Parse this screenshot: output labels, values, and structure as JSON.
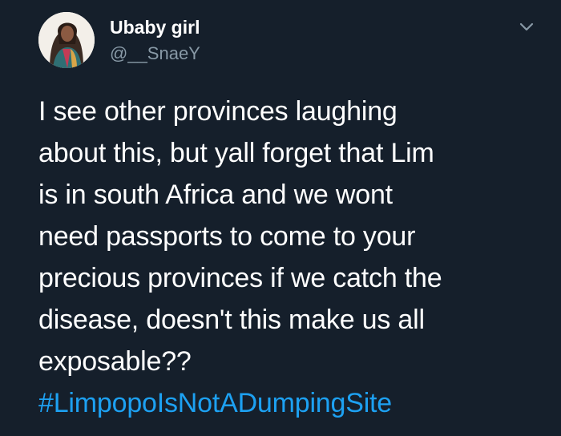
{
  "author": {
    "display_name": "Ubaby girl",
    "handle": "@__SnaeY"
  },
  "menu": {
    "caret_icon": "chevron-down-icon"
  },
  "tweet": {
    "lines": [
      "I see other provinces laughing",
      "about this, but yall forget that Lim",
      "is in south Africa and we wont",
      "need passports to come to your",
      "precious provinces if we catch the",
      "disease, doesn't this make us all",
      "exposable??"
    ],
    "hashtag": "#LimpopoIsNotADumpingSite"
  },
  "colors": {
    "background": "#151f2b",
    "text": "#ffffff",
    "handle": "#8899a6",
    "link": "#1da1f2"
  }
}
